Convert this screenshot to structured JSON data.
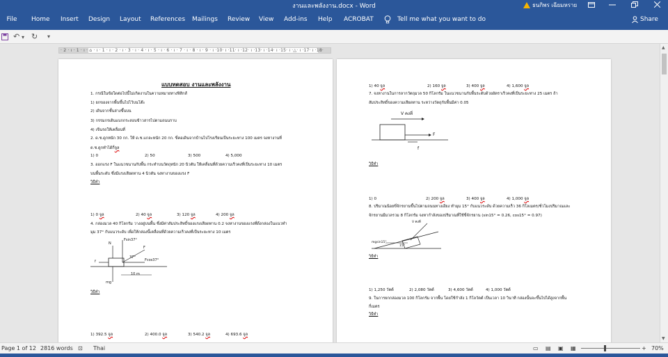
{
  "window": {
    "title": "งานและพลังงาน.docx - Word",
    "user": "ธนกิพร เฉียมหราย"
  },
  "ribbon": {
    "tabs": [
      "File",
      "Home",
      "Insert",
      "Design",
      "Layout",
      "References",
      "Mailings",
      "Review",
      "View",
      "Add-ins",
      "Help",
      "ACROBAT"
    ],
    "tell_me": "Tell me what you want to do",
    "share": "Share"
  },
  "ruler": {
    "text": "· 2 · ı · 1 · ı · ⌂ · ı · 1 · ı · 2 · ı · 3 · ı · 4 · ı · 5 · ı · 6 · ı · 7 · ı · 8 · ı · 9 · ı ·10· ı ·11· ı ·12· ı ·13· ı ·14· ı ·15· ı ·△· ı ·17· ı ·18·"
  },
  "page1": {
    "title": "แบบทดสอบ งานและพลังงาน",
    "lines": [
      "1. กรณีในข้อใดต่อไปนี้ไม่เกิดงานในความหมายทางฟิสิกส์",
      "1) ยกของจากพื้นขึ้นไปไว้บนโต๊ะ",
      "2) เดินจากชั้นล่างขึ้นบน",
      "3) กรรมกรเดินแบกกระสอบข้าวสารไปตามถนนราบ",
      "4) เข็นรถให้เคลื่อนที่",
      "2. ด.ช.ดูกหนัก 30 กก. ให้ ด.ช.แกละหนัก 20 กก. ขี่คอเดินจากบ้านไปโรงเรียนเป็นระยะทาง 100 เมตร จงหางานที่",
      "ด.ช.ดูกทำได้กี่",
      "1) 0",
      "2) 50",
      "3) 500",
      "4) 5,000",
      "3. ออกแรง F ในแนวขนานกับพื้น กระทำบนวัตถุหนัก 20 นิวตัน ให้เคลื่อนที่ด้วยความเร็วคงที่เป็นระยะทาง 10 เมตร",
      "บนพื้นระดับ ซึ่งมีแรงเสียดทาน 4 นิวตัน จงหางานของแรง F",
      "วิธีทำ",
      "1) 0",
      "2) 40",
      "3) 120",
      "4) 200",
      "4. กล่องมวล 40 กิโลกรัม วางอยู่บนพื้น ซึ่งมีค่าสัมประสิทธิ์ของแรงเสียดทาน 0.2 จงหางานของแรงที่ดึงกล่องในแนวทำ",
      "มุม 37° กับแนวระดับ เพื่อให้กล่องนี้เคลื่อนที่ด้วยความเร็วคงที่เป็นระยะทาง 10 เมตร",
      "วิธีทำ",
      "1) 392.5",
      "2) 400.0",
      "3) 540.2",
      "4) 693.6"
    ],
    "diagram": {
      "n": "N",
      "fsin": "Fsin37°",
      "f": "F",
      "angle": "37°",
      "fcos": "Fcos37°",
      "f_small": "f",
      "dist": "10 m",
      "mg": "mg"
    }
  },
  "page2": {
    "lines": [
      "1) 40",
      "2) 160",
      "3) 400",
      "4) 1,600",
      "7. จงหางานในการลากวัตถุมวล 50 กิโลกรัม ในแนวขนานกับพื้นระดับด้วยอัตราเร็วคงที่เป็นระยะทาง 25 เมตร ถ้า",
      "สัมประสิทธิ์ของความเสียดทาน ระหว่างวัตถุกับพื้นมีค่า 0.05",
      "วิธีทำ",
      "1) 0",
      "2) 200",
      "3) 400",
      "4) 1,000",
      "8. ปริมาณน้อยขี่จักรยานขึ้นไปตามถนนทางเอียง ทำมุม 15° กับแนวระดับ ด้วยความเร็ว 36 กิโลเมตร/ชั่วโมงปริมาณและ",
      "จักรยานมีมวลรวม 8 กิโลกรัม จงหากำลังของปริมาณที่ใช้ขี่จักรยาน (sin15° = 0.26, cos15° = 0.97)",
      "วิธีทำ",
      "1) 1,250 วัตต์",
      "2) 2,080 วัตต์",
      "3) 4,600 วัตต์",
      "4) 1,000 วัตต์",
      "9. ในการยกกล่องมวล 100 กิโลกรัม จากพื้น โดยใช้กำลัง 1 กิโลวัตต์ เป็นเวลา 10 วินาที กล่องนั้นจะขึ้นไปได้สูงจากพื้น",
      "กี่เมตร",
      "วิธีทำ"
    ],
    "unit": "จูล",
    "diagram": {
      "v": "V คงที่",
      "f": "F",
      "f_small": "f",
      "v2": "V คงที่",
      "mgsin": "mgsin15°",
      "angle": "15°"
    }
  },
  "status": {
    "page": "Page 1 of 12",
    "words": "2816 words",
    "lang": "Thai",
    "zoom": "70%"
  }
}
